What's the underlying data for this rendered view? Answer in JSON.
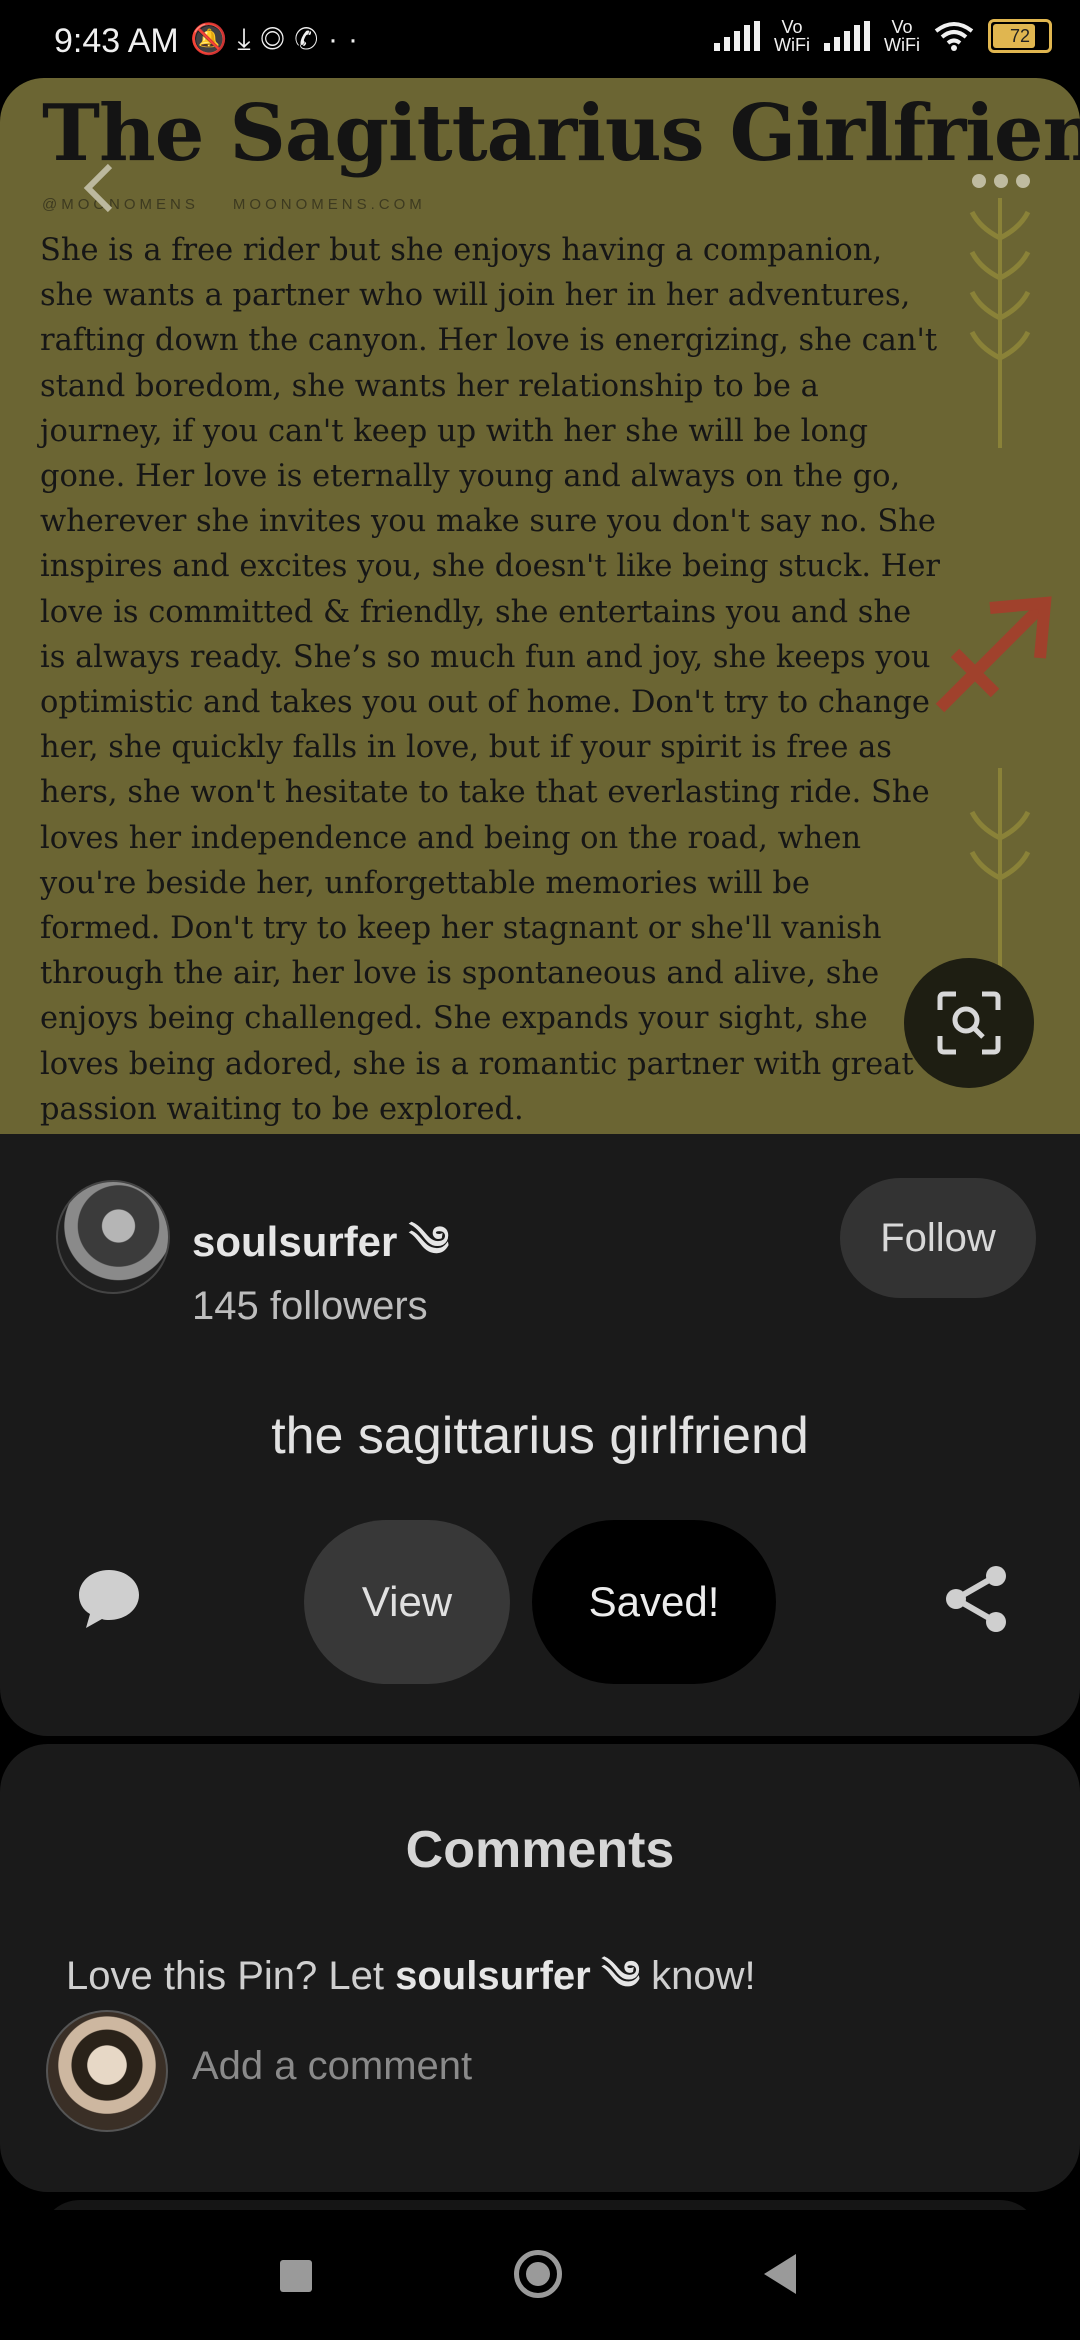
{
  "status_bar": {
    "time": "9:43 AM",
    "icons": [
      "mute-icon",
      "download-icon",
      "chrome-icon",
      "whatsapp-icon",
      "more-dots-icon"
    ],
    "vo_wifi_label_1": "Vo\nWiFi",
    "vo_wifi_label_2": "Vo\nWiFi",
    "battery_level": "72"
  },
  "pin": {
    "image_title": "The Sagittarius Girlfriend",
    "credit_handle": "@MOONOMENS",
    "credit_site": "MOONOMENS.COM",
    "image_text": "She is a free rider but she enjoys having a companion, she wants a partner who will join her in her adventures, rafting down the canyon. Her love is energizing, she can't stand boredom, she wants her relationship to be a journey, if you can't keep up with her she will be long gone. Her love is eternally young and always on the go, wherever she invites you make sure you don't say no. She inspires and excites you, she doesn't like being stuck. Her love is committed & friendly, she entertains you and she is always ready. She’s so much fun and joy, she keeps you optimistic and takes you out of home. Don't try to change her, she quickly falls in love, but if your spirit is free as hers, she won't hesitate to take that everlasting ride. She loves her independence and being on the road, when you're beside her, unforgettable memories will be formed. Don't try to keep her stagnant or she'll vanish through the air, her love is spontaneous and alive, she enjoys being challenged. She expands your sight, she loves being adored, she is a romantic partner with great passion waiting to be explored."
  },
  "creator": {
    "username": "soulsurfer",
    "badge": "༄",
    "followers": "145 followers",
    "follow_label": "Follow"
  },
  "caption": "the sagittarius girlfriend",
  "actions": {
    "view_label": "View",
    "saved_label": "Saved!"
  },
  "comments": {
    "title": "Comments",
    "prompt_pre": "Love this Pin? Let ",
    "prompt_user": "soulsurfer ༄",
    "prompt_post": " know!",
    "placeholder": "Add a comment"
  },
  "colors": {
    "pin_background": "#6b6533",
    "panel_background": "#1a1a1a",
    "saved_button": "#000000",
    "arrow_accent": "#a0412c"
  }
}
